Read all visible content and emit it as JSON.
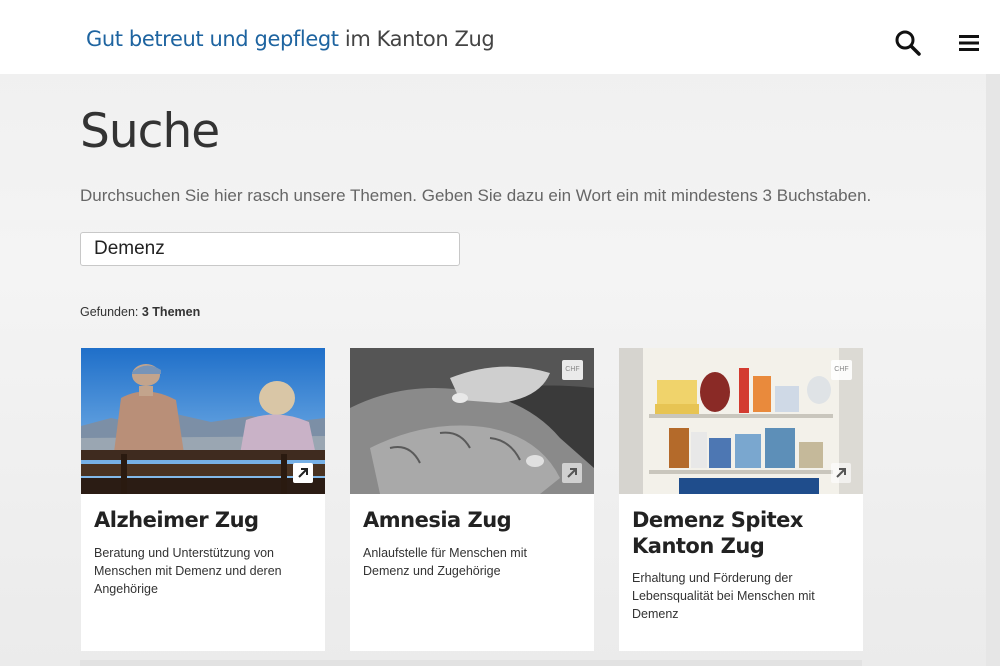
{
  "header": {
    "brand": "Gut betreut und gepflegt",
    "region": "im Kanton Zug",
    "search_icon": "search-icon",
    "menu_icon": "hamburger-menu-icon"
  },
  "main": {
    "title": "Suche",
    "intro": "Durchsuchen Sie hier rasch unsere Themen. Geben Sie dazu ein Wort ein mit mindestens 3 Buchstaben.",
    "search_value": "Demenz",
    "results_label": "Gefunden:",
    "results_value": "3 Themen"
  },
  "cards": [
    {
      "title": "Alzheimer Zug",
      "description": "Beratung und Unterstützung von Menschen mit Demenz und deren Angehörige",
      "icon": "external-link-icon"
    },
    {
      "title": "Amnesia Zug",
      "description": "Anlaufstelle für Menschen mit Demenz und Zugehörige",
      "badge": "CHF",
      "icon": "external-link-icon"
    },
    {
      "title": "Demenz Spitex Kanton Zug",
      "description": "Erhaltung und Förderung der Lebensqualität bei Menschen mit Demenz",
      "badge": "CHF",
      "icon": "external-link-icon"
    }
  ],
  "colors": {
    "brand_blue": "#1e64a0",
    "text_dark": "#333333",
    "text_muted": "#666666"
  }
}
